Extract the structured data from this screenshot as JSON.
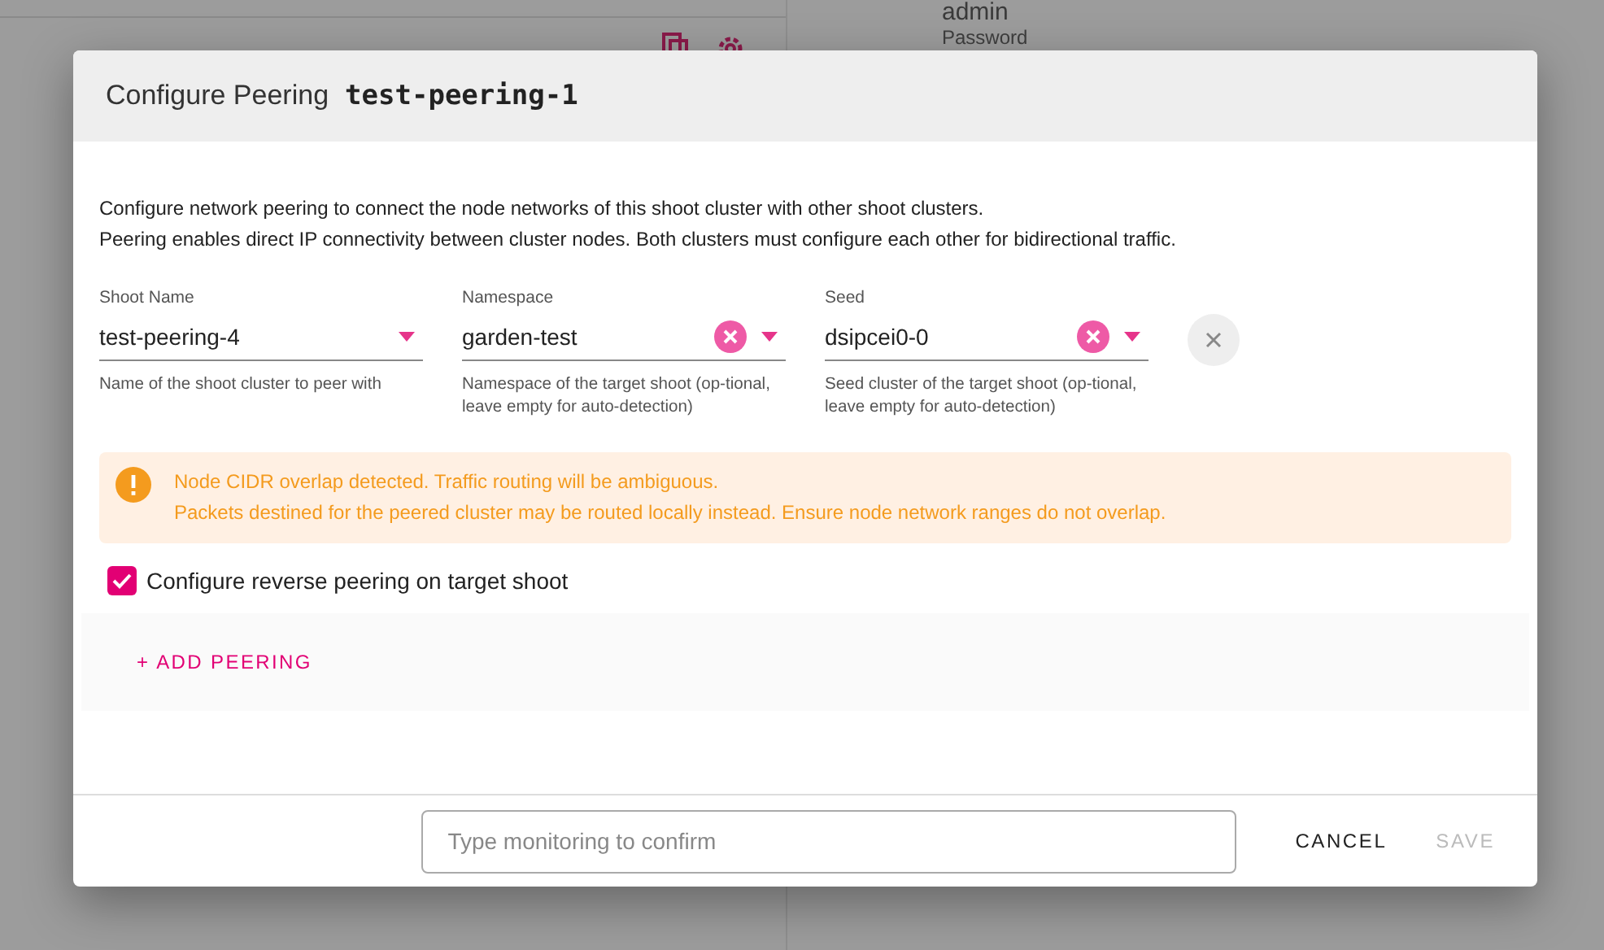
{
  "background": {
    "username": "admin",
    "password_label": "Password"
  },
  "dialog": {
    "title": "Configure Peering",
    "name": "test-peering-1",
    "description": [
      "Configure network peering to connect the node networks of this shoot cluster with other shoot clusters.",
      "Peering enables direct IP connectivity between cluster nodes. Both clusters must configure each other for bidirectional traffic."
    ],
    "fields": [
      {
        "label": "Shoot Name",
        "value": "test-peering-4",
        "clearable": false,
        "hint": "Name of the shoot cluster to peer with"
      },
      {
        "label": "Namespace",
        "value": "garden-test",
        "clearable": true,
        "hint": "Namespace of the target shoot (op-tional, leave empty for auto-detection)"
      },
      {
        "label": "Seed",
        "value": "dsipcei0-0",
        "clearable": true,
        "hint": "Seed cluster of the target shoot (op-tional, leave empty for auto-detection)"
      }
    ],
    "warning": [
      "Node CIDR overlap detected. Traffic routing will be ambiguous.",
      "Packets destined for the peered cluster may be routed locally instead. Ensure node network ranges do not overlap."
    ],
    "reverse_peering": {
      "label": "Configure reverse peering on target shoot",
      "checked": true
    },
    "add_button": "+ ADD PEERING",
    "confirm": {
      "placeholder": "Type monitoring to confirm"
    },
    "buttons": [
      {
        "label": "CANCEL",
        "disabled": false
      },
      {
        "label": "SAVE",
        "disabled": true
      }
    ]
  }
}
